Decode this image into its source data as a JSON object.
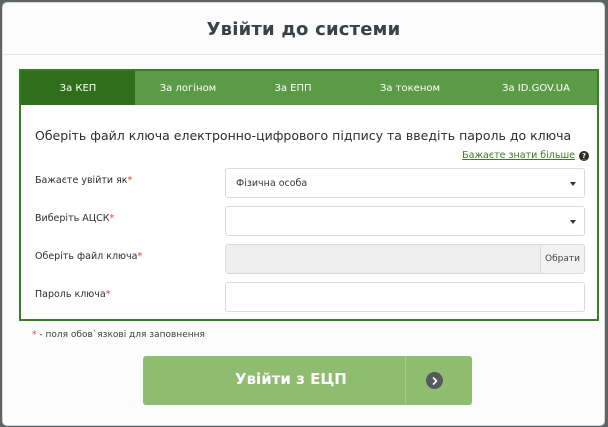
{
  "modal": {
    "title": "Увійти до системи"
  },
  "tabs": [
    {
      "label": "За КЕП",
      "active": true
    },
    {
      "label": "За логіном",
      "active": false
    },
    {
      "label": "За ЕПП",
      "active": false
    },
    {
      "label": "За токеном",
      "active": false
    },
    {
      "label": "За ID.GOV.UA",
      "active": false
    }
  ],
  "panel": {
    "heading": "Оберіть файл ключа електронно-цифрового підпису та введіть пароль до ключа",
    "help_link": "Бажаєте знати більше",
    "help_icon": "question-circle-icon"
  },
  "form": {
    "login_as": {
      "label": "Бажаєте увійти як",
      "value": "Фізична особа"
    },
    "acsk": {
      "label": "Виберіть АЦСК",
      "value": ""
    },
    "key_file": {
      "label": "Оберіть файл ключа",
      "value": "",
      "button": "Обрати"
    },
    "password": {
      "label": "Пароль ключа",
      "value": ""
    },
    "required_mark": "*"
  },
  "footnote": {
    "mark": "*",
    "text": " - поля обов`язкові для заповнення"
  },
  "submit": {
    "label": "Увійти з ЕЦП",
    "icon": "chevron-right-circle-icon"
  },
  "colors": {
    "tab_bar": "#5c9b45",
    "tab_active": "#2f6f1c",
    "submit": "#8fbd70",
    "required": "#e53935"
  }
}
